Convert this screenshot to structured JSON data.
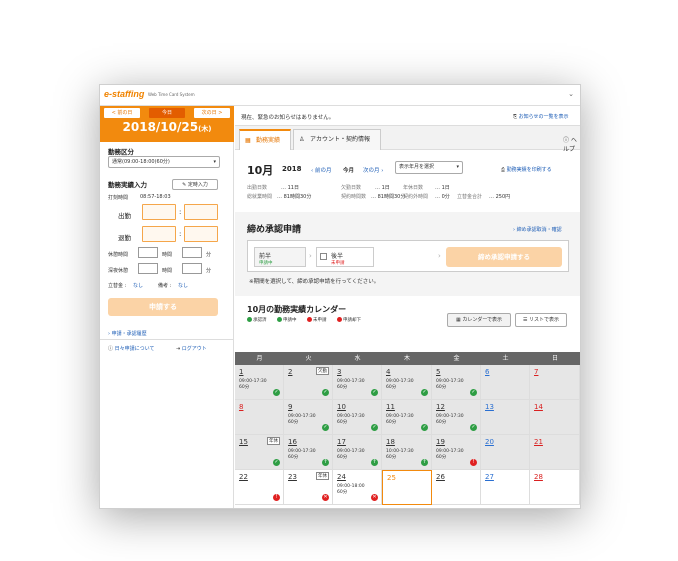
{
  "app": {
    "logo": "e-staffing",
    "subtitle": "Web Time Card System",
    "collapse_icon": "chevron-down-icon"
  },
  "left": {
    "prev_day": "< 前の日",
    "today": "今日",
    "next_day": "次の日 >",
    "date": "2018/10/25",
    "weekday": "(木)",
    "kinmu_kubun_label": "勤務区分",
    "kinmu_kubun_value": "通常(09:00-18:00(60分)",
    "jisseki_label": "勤務実績入力",
    "teikei_button": "定時入力",
    "dakoku_label": "打刻時間",
    "dakoku_value": "08:57-18:03",
    "shukkin_label": "出勤",
    "taikin_label": "退勤",
    "kyukei_label": "休憩時間",
    "shinya_label": "深夜休憩",
    "jikan_unit": "時間",
    "fun_unit": "分",
    "tatekae_label": "立替金 :",
    "tatekae_value": "なし",
    "biko_label": "備考 :",
    "biko_value": "なし",
    "submit_label": "申請する",
    "history_link": "申請・承認履歴",
    "about_link": "日々申請について",
    "logout_link": "ログアウト"
  },
  "notice": {
    "text": "現在、緊急のお知らせはありません。",
    "list_link": "お知らせの一覧を表示"
  },
  "tabs": [
    {
      "label": "勤務実績"
    },
    {
      "label": "アカウント・契約情報"
    }
  ],
  "help_link": "ヘルプ",
  "month": {
    "month": "10月",
    "year": "2018",
    "prev": "前の月",
    "current": "今月",
    "next": "次の月",
    "select": "表示年月を選択",
    "print": "勤務実績を印刷する"
  },
  "stats": [
    {
      "label": "出勤日数",
      "value": "11日"
    },
    {
      "label": "欠勤日数",
      "value": "1日"
    },
    {
      "label": "年休日数",
      "value": "1日"
    },
    {
      "label": "総就業時間",
      "value": "81時間30分"
    },
    {
      "label": "契約時間数",
      "value": "81時間30分"
    },
    {
      "label": "契約外時間",
      "value": "0分"
    },
    {
      "label": "立替金合計",
      "value": "250円"
    }
  ],
  "approval": {
    "title": "締め承認申請",
    "cancel_link": "締め承認取消・確認",
    "first_half": "前半",
    "first_status": "申請中",
    "second_half": "後半",
    "second_status": "未申請",
    "submit": "締め承認申請する",
    "note": "※期間を選択して、締め承認申請を行ってください。"
  },
  "calendar": {
    "title": "10月の勤務実績カレンダー",
    "legend": [
      "承認済",
      "申請中",
      "未申請",
      "申請却下"
    ],
    "cal_view": "カレンダーで表示",
    "list_view": "リストで表示",
    "weekdays": [
      "月",
      "火",
      "水",
      "木",
      "金",
      "土",
      "日"
    ],
    "rows": [
      [
        {
          "d": "1",
          "t": "09:00-17:30",
          "b": "60分",
          "s": "ok",
          "gray": true
        },
        {
          "d": "2",
          "badge": "欠勤",
          "s": "ok",
          "gray": true
        },
        {
          "d": "3",
          "t": "09:00-17:30",
          "b": "60分",
          "s": "ok",
          "gray": true
        },
        {
          "d": "4",
          "t": "09:00-17:30",
          "b": "60分",
          "s": "ok",
          "gray": true
        },
        {
          "d": "5",
          "t": "09:00-17:30",
          "b": "60分",
          "s": "ok",
          "gray": true
        },
        {
          "d": "6",
          "c": "blue",
          "gray": true
        },
        {
          "d": "7",
          "c": "red",
          "gray": true
        }
      ],
      [
        {
          "d": "8",
          "c": "red",
          "gray": true
        },
        {
          "d": "9",
          "t": "09:00-17:30",
          "b": "60分",
          "s": "ok",
          "gray": true
        },
        {
          "d": "10",
          "t": "09:00-17:30",
          "b": "60分",
          "s": "ok",
          "gray": true
        },
        {
          "d": "11",
          "t": "09:00-17:30",
          "b": "60分",
          "s": "ok",
          "gray": true
        },
        {
          "d": "12",
          "t": "09:00-17:30",
          "b": "60分",
          "s": "ok",
          "gray": true
        },
        {
          "d": "13",
          "c": "blue",
          "gray": true
        },
        {
          "d": "14",
          "c": "red",
          "gray": true
        }
      ],
      [
        {
          "d": "15",
          "badge": "年休",
          "s": "ok",
          "gray": true
        },
        {
          "d": "16",
          "t": "09:00-17:30",
          "b": "60分",
          "s": "up",
          "gray": true
        },
        {
          "d": "17",
          "t": "09:00-17:30",
          "b": "60分",
          "s": "up",
          "gray": true
        },
        {
          "d": "18",
          "t": "10:00-17:30",
          "b": "60分",
          "s": "up",
          "gray": true
        },
        {
          "d": "19",
          "t": "09:00-17:30",
          "b": "60分",
          "s": "warn",
          "gray": true
        },
        {
          "d": "20",
          "c": "blue",
          "gray": true
        },
        {
          "d": "21",
          "c": "red",
          "gray": true
        }
      ],
      [
        {
          "d": "22",
          "s": "warn",
          "gray": false
        },
        {
          "d": "23",
          "badge": "年休",
          "s": "x",
          "gray": false
        },
        {
          "d": "24",
          "t": "09:00-18:00",
          "b": "60分",
          "s": "x",
          "gray": false
        },
        {
          "d": "25",
          "c": "orange",
          "sel": true,
          "gray": false
        },
        {
          "d": "26",
          "gray": false
        },
        {
          "d": "27",
          "c": "blue",
          "gray": false
        },
        {
          "d": "28",
          "c": "red",
          "gray": false
        }
      ]
    ]
  },
  "colors": {
    "brand": "#f28a0e",
    "ok": "#2e9e44",
    "warn": "#e02020",
    "link": "#1a5bb5"
  }
}
